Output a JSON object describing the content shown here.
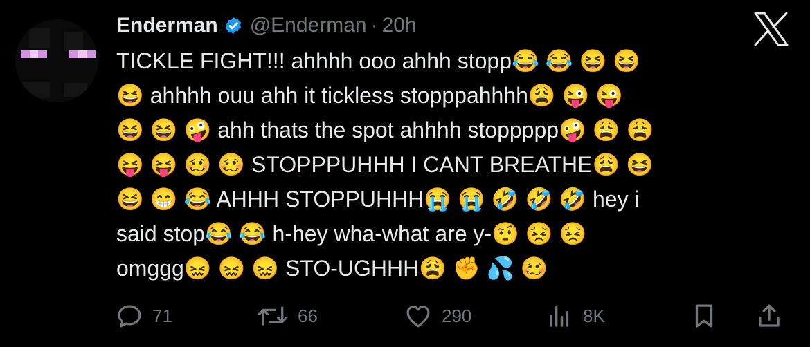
{
  "author": {
    "name": "Enderman",
    "handle": "@Enderman",
    "separator": "·",
    "time": "20h"
  },
  "tweet_lines": [
    "TICKLE FIGHT!!! ahhhh ooo ahhh stopp😂 😂 😆 😆",
    "😆 ahhhh ouu ahh it tickless stopppahhhh😩 😜 😜",
    "😆 😆 🤪 ahh thats the spot ahhhh stoppppp🤪 😩 😩",
    "😝 😝 🥴 🥴 STOPPPUHHH I CANT BREATHE😩 😆",
    "😆 😁 😂 AHHH STOPPUHHH😭 😭 🤣 🤣 🤣 hey i",
    "said stop😂 😂  h-hey wha-what are y-🤨 😣 😣",
    "omggg😖 😖 😖  STO-UGHHH😩 ✊ 💦 🥴"
  ],
  "actions": {
    "replies": "71",
    "reposts": "66",
    "likes": "290",
    "views": "8K"
  },
  "icons": {
    "verified": "verified-badge-icon",
    "platform": "x-logo-icon",
    "reply": "reply-icon",
    "repost": "repost-icon",
    "like": "heart-icon",
    "views": "views-icon",
    "bookmark": "bookmark-icon",
    "share": "share-icon"
  },
  "colors": {
    "background": "#000000",
    "text": "#e7e9ea",
    "muted": "#71767b",
    "verified_blue": "#1d9bf0"
  }
}
